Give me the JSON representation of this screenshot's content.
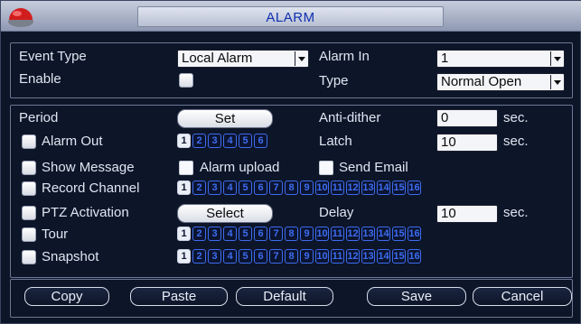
{
  "window": {
    "title": "ALARM"
  },
  "general": {
    "event_type_label": "Event Type",
    "event_type_value": "Local Alarm",
    "alarm_in_label": "Alarm In",
    "alarm_in_value": "1",
    "enable_label": "Enable",
    "enable_checked": false,
    "type_label": "Type",
    "type_value": "Normal Open"
  },
  "settings": {
    "period_label": "Period",
    "period_button": "Set",
    "anti_dither_label": "Anti-dither",
    "anti_dither_value": "0",
    "anti_dither_unit": "sec.",
    "alarm_out_label": "Alarm Out",
    "alarm_out_channels": [
      "1",
      "2",
      "3",
      "4",
      "5",
      "6"
    ],
    "alarm_out_selected": [
      "1"
    ],
    "latch_label": "Latch",
    "latch_value": "10",
    "latch_unit": "sec.",
    "show_message_label": "Show Message",
    "alarm_upload_label": "Alarm upload",
    "send_email_label": "Send Email",
    "record_channel_label": "Record Channel",
    "record_channels": [
      "1",
      "2",
      "3",
      "4",
      "5",
      "6",
      "7",
      "8",
      "9",
      "10",
      "11",
      "12",
      "13",
      "14",
      "15",
      "16"
    ],
    "record_selected": [
      "1"
    ],
    "ptz_activation_label": "PTZ Activation",
    "ptz_button": "Select",
    "delay_label": "Delay",
    "delay_value": "10",
    "delay_unit": "sec.",
    "tour_label": "Tour",
    "tour_channels": [
      "1",
      "2",
      "3",
      "4",
      "5",
      "6",
      "7",
      "8",
      "9",
      "10",
      "11",
      "12",
      "13",
      "14",
      "15",
      "16"
    ],
    "tour_selected": [
      "1"
    ],
    "snapshot_label": "Snapshot",
    "snapshot_channels": [
      "1",
      "2",
      "3",
      "4",
      "5",
      "6",
      "7",
      "8",
      "9",
      "10",
      "11",
      "12",
      "13",
      "14",
      "15",
      "16"
    ],
    "snapshot_selected": [
      "1"
    ]
  },
  "buttons": {
    "copy": "Copy",
    "paste": "Paste",
    "default": "Default",
    "save": "Save",
    "cancel": "Cancel"
  },
  "icons": {
    "app_logo": "red-dome-icon",
    "dropdown": "chevron-down-icon"
  },
  "colors": {
    "background": "#0d1528",
    "title_text": "#0f2fb0",
    "channel_border": "#3d6cf0"
  }
}
